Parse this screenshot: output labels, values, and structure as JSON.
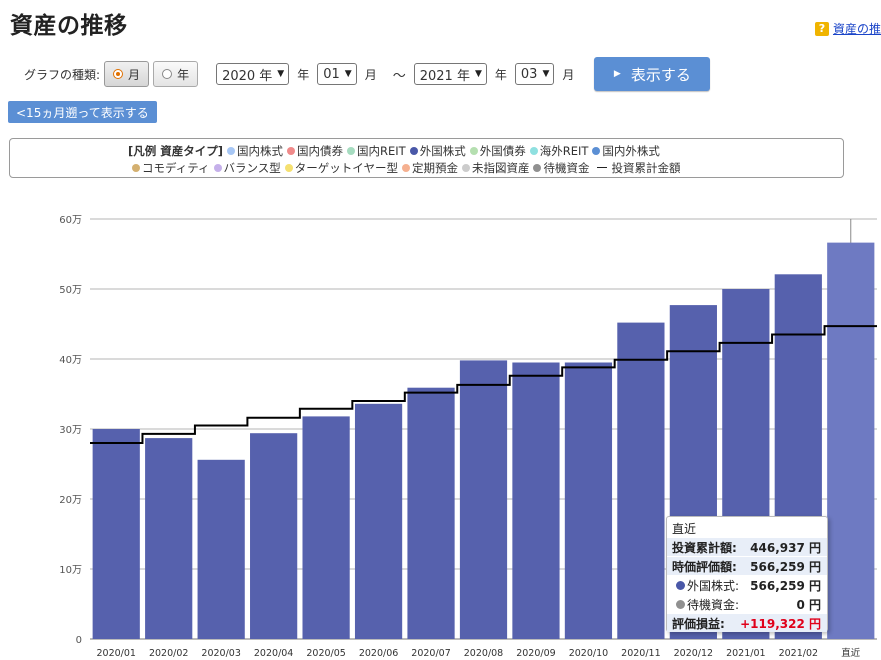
{
  "page": {
    "title": "資産の推移",
    "help_icon": "?",
    "help_text": "資産の推"
  },
  "controls": {
    "graph_type_label": "グラフの種類:",
    "radio_month": "月",
    "radio_year": "年",
    "selected_radio": "月",
    "start_year": "2020 年",
    "start_month": "01",
    "end_year": "2021 年",
    "end_month": "03",
    "year_unit": "年",
    "month_unit": "月",
    "tilde": "～",
    "show_button": "表示する",
    "back_button": "<15ヵ月遡って表示する"
  },
  "legend": {
    "header": "[凡例 資産タイプ]",
    "row1": [
      {
        "label": "国内株式",
        "color": "#a7c7f5"
      },
      {
        "label": "国内債券",
        "color": "#f08a8a"
      },
      {
        "label": "国内REIT",
        "color": "#a6dcc0"
      },
      {
        "label": "外国株式",
        "color": "#4a58a8"
      },
      {
        "label": "外国債券",
        "color": "#b5dfb0"
      },
      {
        "label": "海外REIT",
        "color": "#8fe0e0"
      },
      {
        "label": "国内外株式",
        "color": "#5b8fd4"
      }
    ],
    "row2": [
      {
        "label": "コモディティ",
        "color": "#d4b070"
      },
      {
        "label": "バランス型",
        "color": "#c5b0ea"
      },
      {
        "label": "ターゲットイヤー型",
        "color": "#f5e070"
      },
      {
        "label": "定期預金",
        "color": "#f5b090"
      },
      {
        "label": "未指図資産",
        "color": "#cccccc"
      },
      {
        "label": "待機資金",
        "color": "#909090"
      }
    ],
    "line_item": "投資累計金額"
  },
  "chart_data": {
    "type": "bar",
    "categories": [
      "2020/01",
      "2020/02",
      "2020/03",
      "2020/04",
      "2020/05",
      "2020/06",
      "2020/07",
      "2020/08",
      "2020/09",
      "2020/10",
      "2020/11",
      "2020/12",
      "2021/01",
      "2021/02",
      "直近"
    ],
    "series": [
      {
        "name": "外国株式",
        "type": "bar",
        "color": "#5661ad",
        "values": [
          300000,
          287000,
          256000,
          294000,
          318000,
          336000,
          359000,
          398000,
          395000,
          395000,
          452000,
          477000,
          500000,
          521000,
          566259
        ]
      },
      {
        "name": "投資累計金額",
        "type": "step-line",
        "color": "#000000",
        "values": [
          280000,
          293000,
          305000,
          316000,
          329000,
          340000,
          352000,
          363000,
          376000,
          388000,
          399000,
          411000,
          423000,
          435000,
          446937
        ]
      }
    ],
    "last_bar_color": "#6e7ac2",
    "y_ticks": [
      0,
      100000,
      200000,
      300000,
      400000,
      500000,
      600000
    ],
    "y_tick_labels": [
      "0",
      "10万",
      "20万",
      "30万",
      "40万",
      "50万",
      "60万"
    ],
    "ylim": [
      0,
      600000
    ],
    "grid": true
  },
  "tooltip": {
    "title": "直近",
    "rows": [
      {
        "label": "投資累計額:",
        "value": "446,937 円"
      },
      {
        "label": "時価評価額:",
        "value": "566,259 円"
      },
      {
        "label": "外国株式:",
        "value": "566,259 円",
        "dot": "#4a58a8"
      },
      {
        "label": "待機資金:",
        "value": "0 円",
        "dot": "#909090"
      },
      {
        "label": "評価損益:",
        "value": "+119,322 円"
      }
    ]
  }
}
